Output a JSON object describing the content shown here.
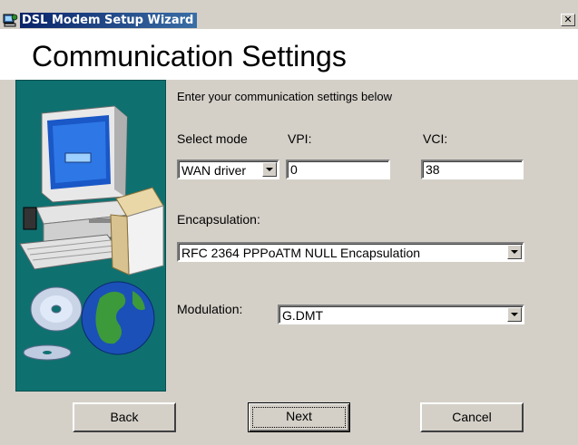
{
  "window": {
    "title": "DSL Modem Setup Wizard",
    "close_glyph": "✕"
  },
  "header": {
    "title": "Communication Settings"
  },
  "form": {
    "instructions": "Enter your communication settings below",
    "mode_label": "Select mode",
    "mode_value": "WAN driver",
    "vpi_label": "VPI:",
    "vpi_value": "0",
    "vci_label": "VCI:",
    "vci_value": "38",
    "encapsulation_label": "Encapsulation:",
    "encapsulation_value": "RFC 2364 PPPoATM NULL Encapsulation",
    "modulation_label": "Modulation:",
    "modulation_value": "G.DMT"
  },
  "buttons": {
    "back": "Back",
    "next": "Next",
    "cancel": "Cancel"
  },
  "colors": {
    "side_panel": "#0f7070",
    "dialog_face": "#d4d0c8",
    "title_gradient_start": "#0a246a"
  },
  "icons": {
    "title": "modem-wizard-icon",
    "artwork": "computer-cd-globe-illustration"
  }
}
